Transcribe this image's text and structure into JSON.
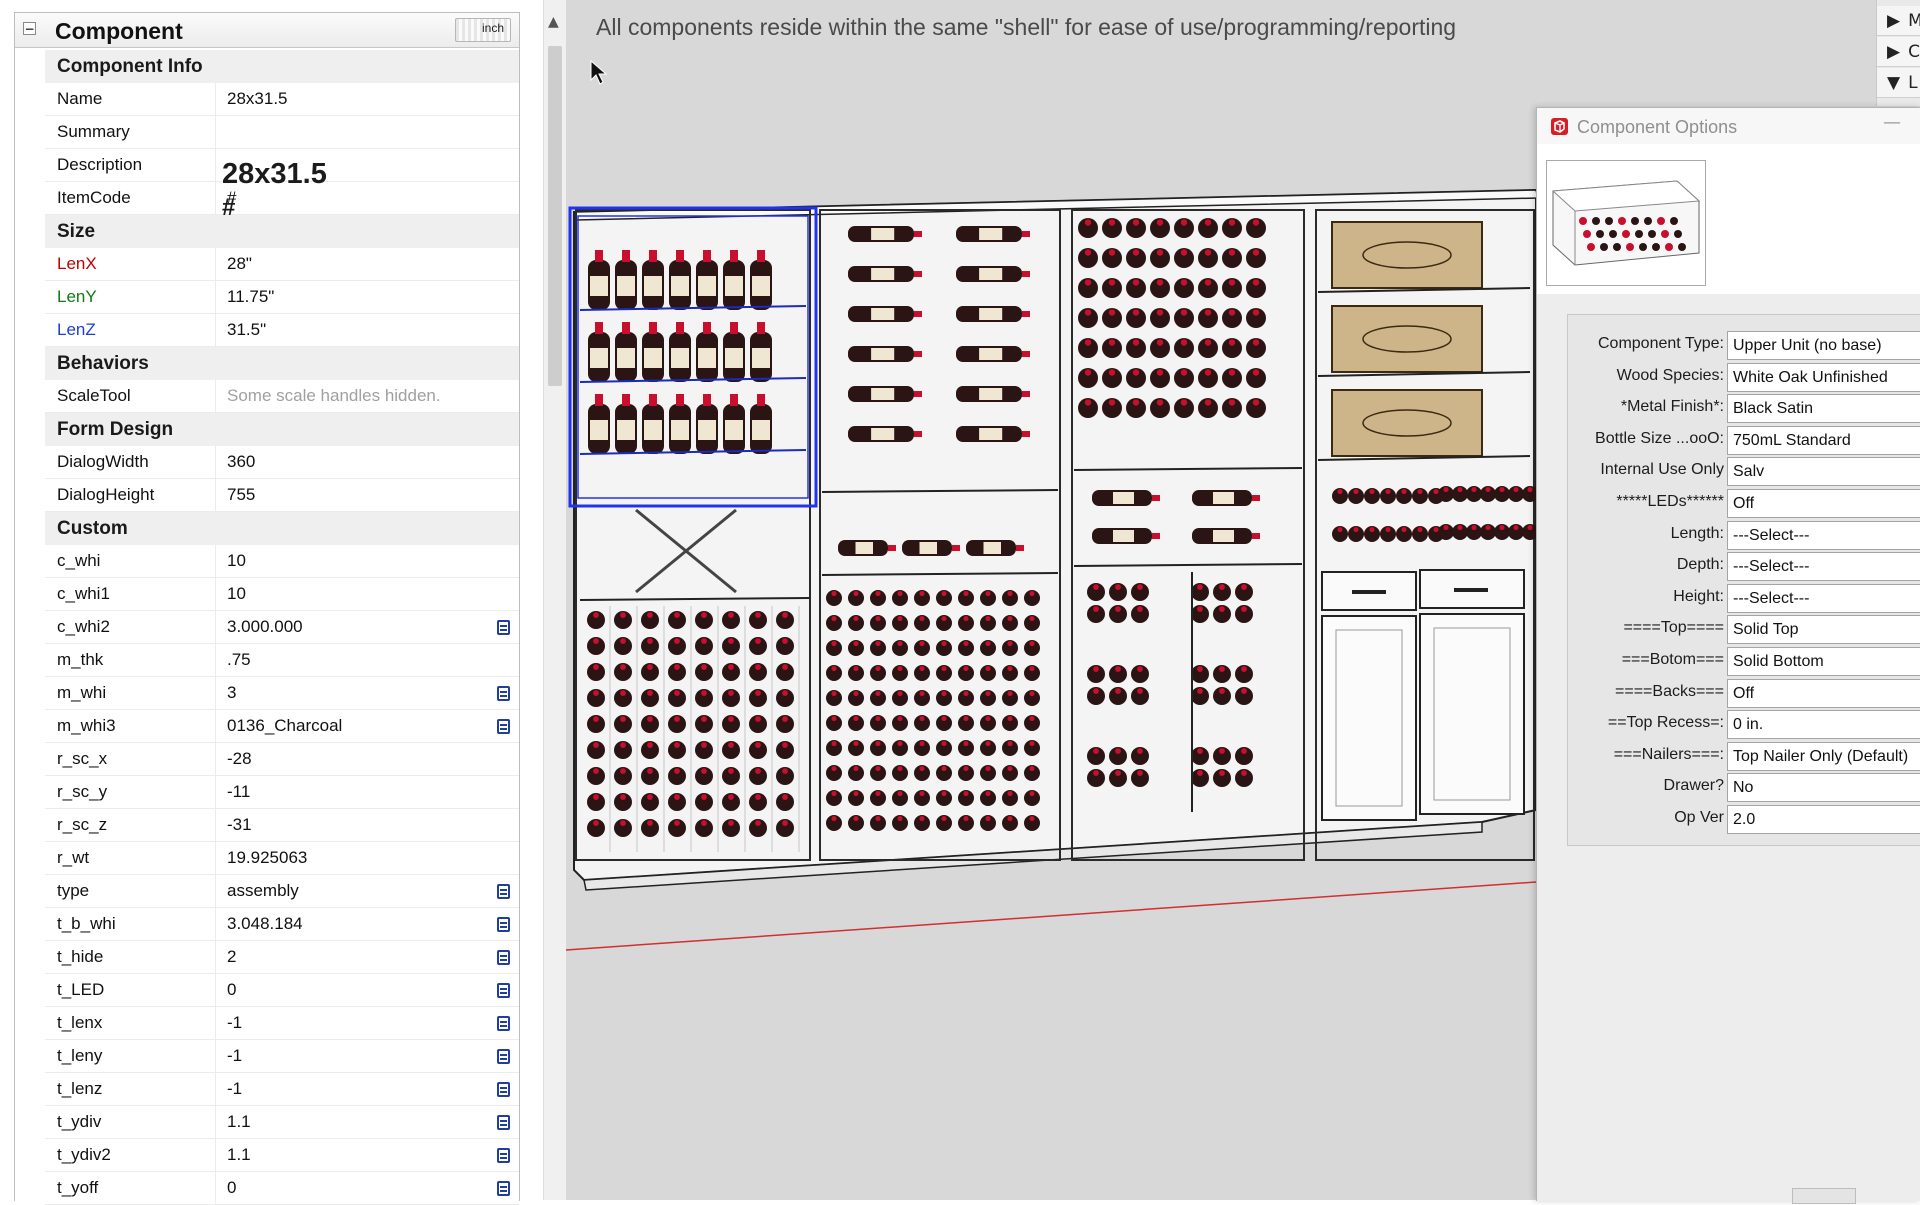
{
  "panel": {
    "title": "Component",
    "collapse_glyph": "−",
    "units": "inch",
    "rows": [
      {
        "kind": "section",
        "label": "Component Info"
      },
      {
        "kind": "attr",
        "label": "Name",
        "value": "28x31.5"
      },
      {
        "kind": "attr",
        "label": "Summary",
        "value": ""
      },
      {
        "kind": "attr",
        "label": "Description",
        "value": ""
      },
      {
        "kind": "attr",
        "label": "ItemCode",
        "value": "#"
      },
      {
        "kind": "section",
        "label": "Size"
      },
      {
        "kind": "attr",
        "label": "LenX",
        "value": "28\"",
        "labelColor": "lenx"
      },
      {
        "kind": "attr",
        "label": "LenY",
        "value": "11.75\"",
        "labelColor": "leny"
      },
      {
        "kind": "attr",
        "label": "LenZ",
        "value": "31.5\"",
        "labelColor": "lenz"
      },
      {
        "kind": "section",
        "label": "Behaviors"
      },
      {
        "kind": "attr",
        "label": "ScaleTool",
        "value": "Some scale handles hidden.",
        "hint": true
      },
      {
        "kind": "section",
        "label": "Form Design"
      },
      {
        "kind": "attr",
        "label": "DialogWidth",
        "value": "360"
      },
      {
        "kind": "attr",
        "label": "DialogHeight",
        "value": "755"
      },
      {
        "kind": "section",
        "label": "Custom"
      },
      {
        "kind": "attr",
        "label": "c_whi",
        "value": "10"
      },
      {
        "kind": "attr",
        "label": "c_whi1",
        "value": "10"
      },
      {
        "kind": "attr",
        "label": "c_whi2",
        "value": "3.000.000",
        "fx": true
      },
      {
        "kind": "attr",
        "label": "m_thk",
        "value": ".75"
      },
      {
        "kind": "attr",
        "label": "m_whi",
        "value": "3",
        "fx": true
      },
      {
        "kind": "attr",
        "label": "m_whi3",
        "value": "0136_Charcoal",
        "fx": true
      },
      {
        "kind": "attr",
        "label": "r_sc_x",
        "value": "-28"
      },
      {
        "kind": "attr",
        "label": "r_sc_y",
        "value": "-11"
      },
      {
        "kind": "attr",
        "label": "r_sc_z",
        "value": "-31"
      },
      {
        "kind": "attr",
        "label": "r_wt",
        "value": "19.925063"
      },
      {
        "kind": "attr",
        "label": "type",
        "value": "assembly",
        "fx": true
      },
      {
        "kind": "attr",
        "label": "t_b_whi",
        "value": "3.048.184",
        "fx": true
      },
      {
        "kind": "attr",
        "label": "t_hide",
        "value": "2",
        "fx": true
      },
      {
        "kind": "attr",
        "label": "t_LED",
        "value": "0",
        "fx": true
      },
      {
        "kind": "attr",
        "label": "t_lenx",
        "value": "-1",
        "fx": true
      },
      {
        "kind": "attr",
        "label": "t_leny",
        "value": "-1",
        "fx": true
      },
      {
        "kind": "attr",
        "label": "t_lenz",
        "value": "-1",
        "fx": true
      },
      {
        "kind": "attr",
        "label": "t_ydiv",
        "value": "1.1",
        "fx": true
      },
      {
        "kind": "attr",
        "label": "t_ydiv2",
        "value": "1.1",
        "fx": true
      },
      {
        "kind": "attr",
        "label": "t_yoff",
        "value": "0",
        "fx": true
      }
    ]
  },
  "viewport": {
    "note": "All components reside within the same \"shell\" for ease of use/programming/reporting",
    "tray_items": [
      {
        "arrow": "▶",
        "label": "M"
      },
      {
        "arrow": "▶",
        "label": "C"
      },
      {
        "arrow": "▼",
        "label": "L"
      }
    ]
  },
  "dialog": {
    "title": "Component Options",
    "minimize_glyph": "—",
    "component_name": "28x31.5",
    "item_code": "#",
    "options": [
      {
        "label": "Component Type:",
        "value": "Upper Unit (no base)"
      },
      {
        "label": "Wood Species:",
        "value": "White Oak Unfinished"
      },
      {
        "label": "*Metal Finish*:",
        "value": "Black Satin"
      },
      {
        "label": "Bottle Size ...ooO:",
        "value": "750mL Standard"
      },
      {
        "label": "Internal Use Only",
        "value": "Salv"
      },
      {
        "label": "*****LEDs******",
        "value": "Off"
      },
      {
        "label": "Length:",
        "value": "---Select---"
      },
      {
        "label": "Depth:",
        "value": "---Select---"
      },
      {
        "label": "Height:",
        "value": "---Select---"
      },
      {
        "label": "====Top====",
        "value": "Solid Top"
      },
      {
        "label": "===Botom===",
        "value": "Solid Bottom"
      },
      {
        "label": "====Backs===",
        "value": "Off"
      },
      {
        "label": "==Top Recess=:",
        "value": "0 in."
      },
      {
        "label": "===Nailers===:",
        "value": "Top Nailer Only (Default)"
      },
      {
        "label": "Drawer?",
        "value": "No"
      },
      {
        "label": "Op Ver",
        "value": "2.0"
      }
    ]
  },
  "colors": {
    "selection": "#2233ee",
    "axis_red": "#d03030",
    "bottle_dark": "#2a1414",
    "bottle_cap": "#c8102e",
    "bottle_label": "#efe7d2",
    "crate_wood": "#cdb489"
  }
}
